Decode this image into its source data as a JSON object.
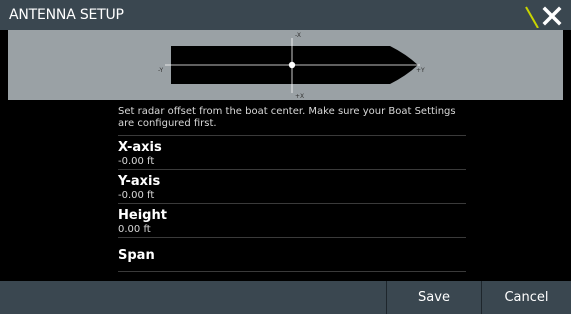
{
  "window": {
    "title": "ANTENNA SETUP",
    "close_icon": "close-icon"
  },
  "preview": {
    "axis_labels": {
      "neg_x": "-X",
      "pos_x": "+X",
      "neg_y": "-Y",
      "pos_y": "+Y"
    },
    "colors": {
      "background": "#9aa1a5",
      "boat": "#000000",
      "axis": "#ffffff"
    }
  },
  "info_text": "Set radar offset from the boat center. Make sure your Boat Settings are configured first.",
  "rows": [
    {
      "label": "X-axis",
      "value": "-0.00 ft"
    },
    {
      "label": "Y-axis",
      "value": "-0.00 ft"
    },
    {
      "label": "Height",
      "value": "0.00 ft"
    },
    {
      "label": "Span"
    }
  ],
  "footer": {
    "save_label": "Save",
    "cancel_label": "Cancel"
  },
  "colors": {
    "bar": "#3a4750",
    "accent": "#c8d400"
  }
}
